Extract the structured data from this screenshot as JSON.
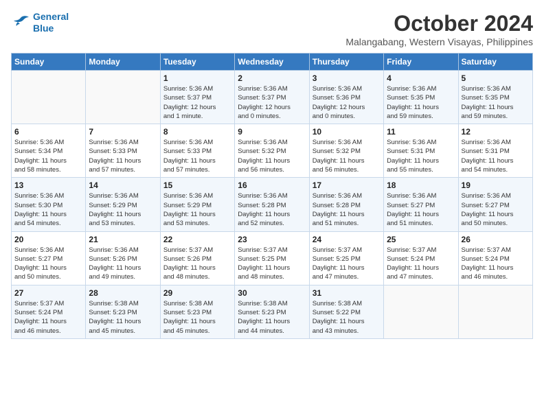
{
  "logo": {
    "line1": "General",
    "line2": "Blue"
  },
  "title": "October 2024",
  "subtitle": "Malangabang, Western Visayas, Philippines",
  "days_of_week": [
    "Sunday",
    "Monday",
    "Tuesday",
    "Wednesday",
    "Thursday",
    "Friday",
    "Saturday"
  ],
  "weeks": [
    [
      {
        "day": "",
        "info": ""
      },
      {
        "day": "",
        "info": ""
      },
      {
        "day": "1",
        "info": "Sunrise: 5:36 AM\nSunset: 5:37 PM\nDaylight: 12 hours\nand 1 minute."
      },
      {
        "day": "2",
        "info": "Sunrise: 5:36 AM\nSunset: 5:37 PM\nDaylight: 12 hours\nand 0 minutes."
      },
      {
        "day": "3",
        "info": "Sunrise: 5:36 AM\nSunset: 5:36 PM\nDaylight: 12 hours\nand 0 minutes."
      },
      {
        "day": "4",
        "info": "Sunrise: 5:36 AM\nSunset: 5:35 PM\nDaylight: 11 hours\nand 59 minutes."
      },
      {
        "day": "5",
        "info": "Sunrise: 5:36 AM\nSunset: 5:35 PM\nDaylight: 11 hours\nand 59 minutes."
      }
    ],
    [
      {
        "day": "6",
        "info": "Sunrise: 5:36 AM\nSunset: 5:34 PM\nDaylight: 11 hours\nand 58 minutes."
      },
      {
        "day": "7",
        "info": "Sunrise: 5:36 AM\nSunset: 5:33 PM\nDaylight: 11 hours\nand 57 minutes."
      },
      {
        "day": "8",
        "info": "Sunrise: 5:36 AM\nSunset: 5:33 PM\nDaylight: 11 hours\nand 57 minutes."
      },
      {
        "day": "9",
        "info": "Sunrise: 5:36 AM\nSunset: 5:32 PM\nDaylight: 11 hours\nand 56 minutes."
      },
      {
        "day": "10",
        "info": "Sunrise: 5:36 AM\nSunset: 5:32 PM\nDaylight: 11 hours\nand 56 minutes."
      },
      {
        "day": "11",
        "info": "Sunrise: 5:36 AM\nSunset: 5:31 PM\nDaylight: 11 hours\nand 55 minutes."
      },
      {
        "day": "12",
        "info": "Sunrise: 5:36 AM\nSunset: 5:31 PM\nDaylight: 11 hours\nand 54 minutes."
      }
    ],
    [
      {
        "day": "13",
        "info": "Sunrise: 5:36 AM\nSunset: 5:30 PM\nDaylight: 11 hours\nand 54 minutes."
      },
      {
        "day": "14",
        "info": "Sunrise: 5:36 AM\nSunset: 5:29 PM\nDaylight: 11 hours\nand 53 minutes."
      },
      {
        "day": "15",
        "info": "Sunrise: 5:36 AM\nSunset: 5:29 PM\nDaylight: 11 hours\nand 53 minutes."
      },
      {
        "day": "16",
        "info": "Sunrise: 5:36 AM\nSunset: 5:28 PM\nDaylight: 11 hours\nand 52 minutes."
      },
      {
        "day": "17",
        "info": "Sunrise: 5:36 AM\nSunset: 5:28 PM\nDaylight: 11 hours\nand 51 minutes."
      },
      {
        "day": "18",
        "info": "Sunrise: 5:36 AM\nSunset: 5:27 PM\nDaylight: 11 hours\nand 51 minutes."
      },
      {
        "day": "19",
        "info": "Sunrise: 5:36 AM\nSunset: 5:27 PM\nDaylight: 11 hours\nand 50 minutes."
      }
    ],
    [
      {
        "day": "20",
        "info": "Sunrise: 5:36 AM\nSunset: 5:27 PM\nDaylight: 11 hours\nand 50 minutes."
      },
      {
        "day": "21",
        "info": "Sunrise: 5:36 AM\nSunset: 5:26 PM\nDaylight: 11 hours\nand 49 minutes."
      },
      {
        "day": "22",
        "info": "Sunrise: 5:37 AM\nSunset: 5:26 PM\nDaylight: 11 hours\nand 48 minutes."
      },
      {
        "day": "23",
        "info": "Sunrise: 5:37 AM\nSunset: 5:25 PM\nDaylight: 11 hours\nand 48 minutes."
      },
      {
        "day": "24",
        "info": "Sunrise: 5:37 AM\nSunset: 5:25 PM\nDaylight: 11 hours\nand 47 minutes."
      },
      {
        "day": "25",
        "info": "Sunrise: 5:37 AM\nSunset: 5:24 PM\nDaylight: 11 hours\nand 47 minutes."
      },
      {
        "day": "26",
        "info": "Sunrise: 5:37 AM\nSunset: 5:24 PM\nDaylight: 11 hours\nand 46 minutes."
      }
    ],
    [
      {
        "day": "27",
        "info": "Sunrise: 5:37 AM\nSunset: 5:24 PM\nDaylight: 11 hours\nand 46 minutes."
      },
      {
        "day": "28",
        "info": "Sunrise: 5:38 AM\nSunset: 5:23 PM\nDaylight: 11 hours\nand 45 minutes."
      },
      {
        "day": "29",
        "info": "Sunrise: 5:38 AM\nSunset: 5:23 PM\nDaylight: 11 hours\nand 45 minutes."
      },
      {
        "day": "30",
        "info": "Sunrise: 5:38 AM\nSunset: 5:23 PM\nDaylight: 11 hours\nand 44 minutes."
      },
      {
        "day": "31",
        "info": "Sunrise: 5:38 AM\nSunset: 5:22 PM\nDaylight: 11 hours\nand 43 minutes."
      },
      {
        "day": "",
        "info": ""
      },
      {
        "day": "",
        "info": ""
      }
    ]
  ]
}
